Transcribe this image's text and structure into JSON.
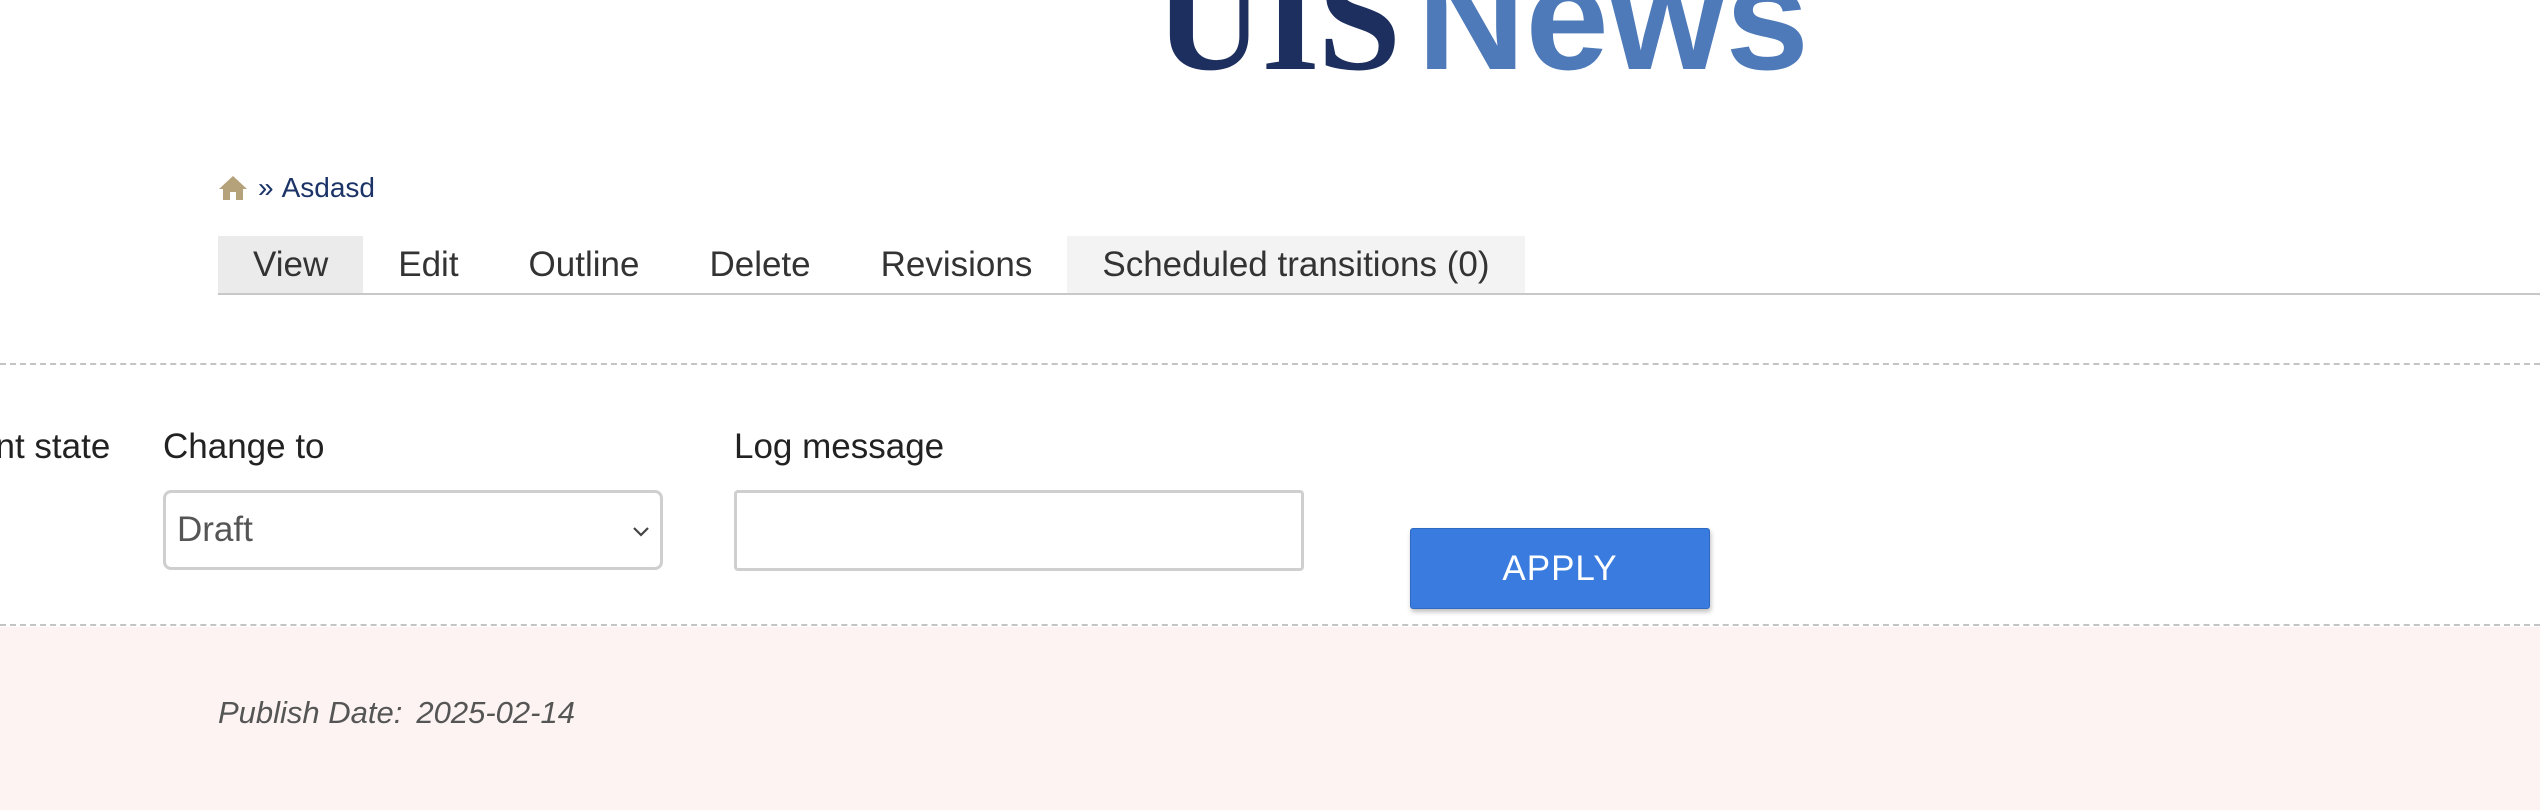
{
  "header": {
    "logo_part1": "UIS",
    "logo_part2": "News"
  },
  "breadcrumb": {
    "home_icon": "home-icon",
    "separator": "»",
    "current": "Asdasd"
  },
  "tabs": [
    {
      "label": "View",
      "active": true
    },
    {
      "label": "Edit",
      "active": false
    },
    {
      "label": "Outline",
      "active": false
    },
    {
      "label": "Delete",
      "active": false
    },
    {
      "label": "Revisions",
      "active": false
    },
    {
      "label": "Scheduled transitions (0)",
      "active": false
    }
  ],
  "moderation": {
    "current_state_label": "Current state",
    "change_to_label": "Change to",
    "change_to_value": "Draft",
    "log_message_label": "Log message",
    "log_message_value": "",
    "apply_label": "APPLY"
  },
  "meta": {
    "publish_label": "Publish Date:",
    "publish_value": "2025-02-14"
  },
  "colors": {
    "logo_dark": "#1d2f5e",
    "logo_light": "#4e7ab9",
    "apply_button": "#3a7bdf",
    "pink_background": "#fcf3f2"
  }
}
